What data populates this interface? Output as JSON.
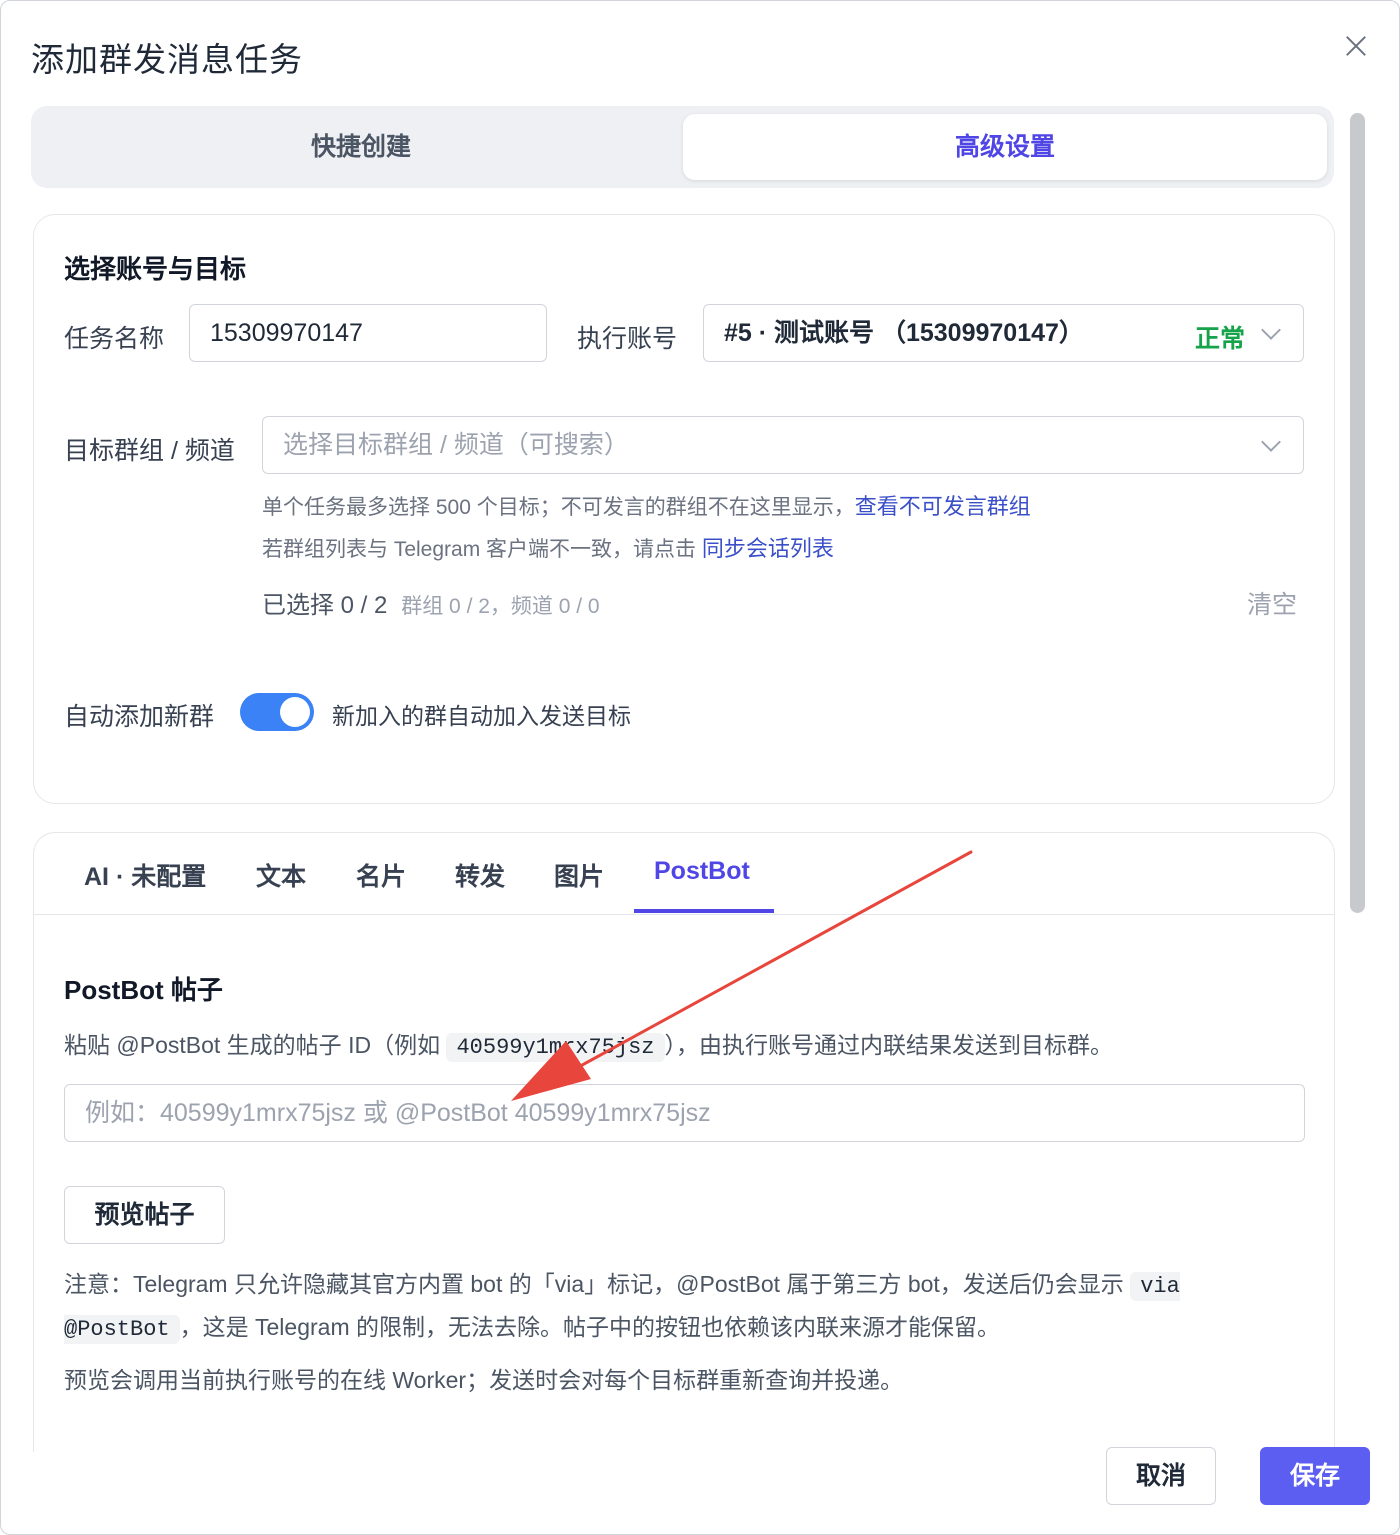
{
  "dialog": {
    "title": "添加群发消息任务"
  },
  "mode_tabs": {
    "quick": "快捷创建",
    "advanced": "高级设置",
    "active": "advanced"
  },
  "target": {
    "section_title": "选择账号与目标",
    "task_name_label": "任务名称",
    "task_name_value": "15309970147",
    "account_label": "执行账号",
    "account_value": "#5 · 测试账号 （15309970147）",
    "account_status": "正常",
    "groups_label": "目标群组 / 频道",
    "groups_placeholder": "选择目标群组 / 频道（可搜索）",
    "hint1": "单个任务最多选择 500 个目标；不可发言的群组不在这里显示，",
    "hint1_link": "查看不可发言群组",
    "hint2": "若群组列表与 Telegram 客户端不一致，请点击 ",
    "hint2_link": "同步会话列表",
    "selected_main": "已选择 0 / 2",
    "selected_detail": "群组 0 / 2，频道 0 / 0",
    "clear": "清空",
    "auto_add_label": "自动添加新群",
    "auto_add_enabled": true,
    "auto_add_desc": "新加入的群自动加入发送目标"
  },
  "content_tabs": [
    "AI · 未配置",
    "文本",
    "名片",
    "转发",
    "图片",
    "PostBot"
  ],
  "content_tab_active": "PostBot",
  "postbot": {
    "title": "PostBot 帖子",
    "desc_pre": "粘贴 @PostBot 生成的帖子 ID（例如 ",
    "desc_code": "40599y1mrx75jsz",
    "desc_post": "），由执行账号通过内联结果发送到目标群。",
    "input_placeholder": "例如：40599y1mrx75jsz 或 @PostBot 40599y1mrx75jsz",
    "preview_button": "预览帖子",
    "note_pre": "注意：Telegram 只允许隐藏其官方内置 bot 的「via」标记，@PostBot 属于第三方 bot，发送后仍会显示 ",
    "note_code": "via @PostBot",
    "note_post": "，这是 Telegram 的限制，无法去除。帖子中的按钮也依赖该内联来源才能保留。",
    "note2": "预览会调用当前执行账号的在线 Worker；发送时会对每个目标群重新查询并投递。"
  },
  "footer": {
    "cancel": "取消",
    "save": "保存"
  },
  "colors": {
    "accent": "#4f46e5",
    "primary_button": "#5b5ef0",
    "status_ok": "#16a34a",
    "toggle_on": "#3b82f6",
    "annotation_arrow": "#e8453c"
  }
}
